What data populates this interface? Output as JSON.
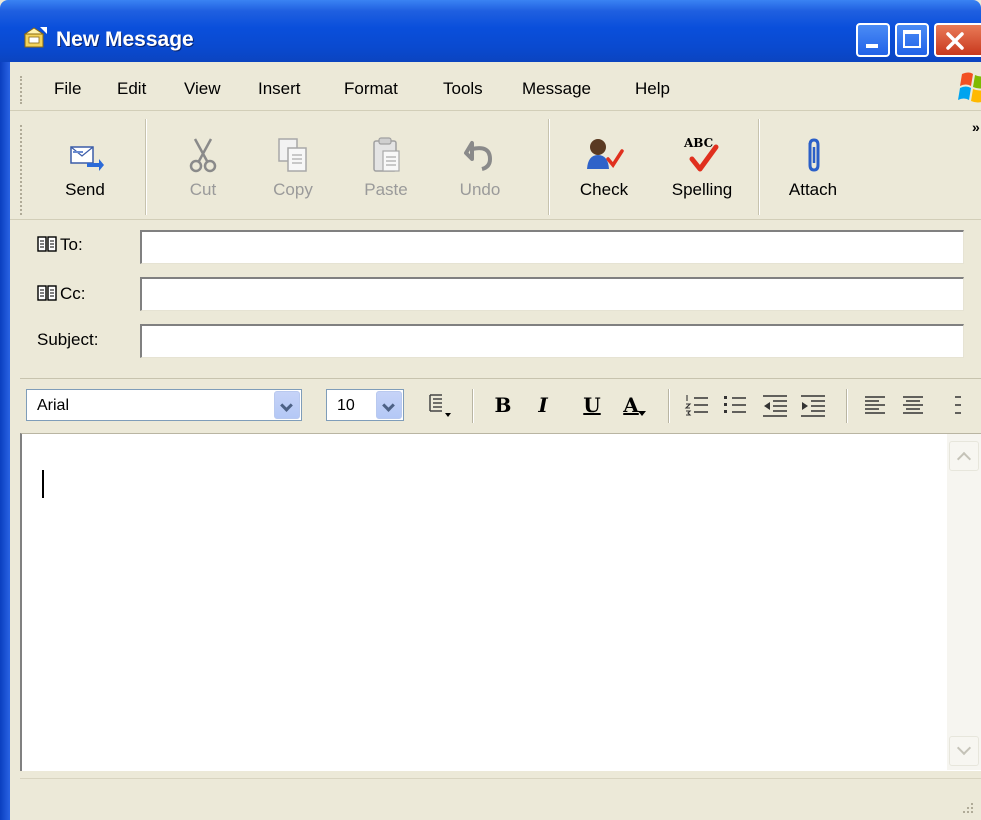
{
  "window": {
    "title": "New Message",
    "accent": "#0a4fdb",
    "controls": [
      "minimize-icon",
      "maximize-icon",
      "close-icon"
    ],
    "close_color": "#c8381d"
  },
  "menu": {
    "items": [
      "File",
      "Edit",
      "View",
      "Insert",
      "Format",
      "Tools",
      "Message",
      "Help"
    ]
  },
  "toolbar": {
    "buttons": [
      {
        "label": "Send",
        "icon": "send-icon",
        "enabled": true
      },
      {
        "label": "Cut",
        "icon": "scissors-icon",
        "enabled": false
      },
      {
        "label": "Copy",
        "icon": "copy-icon",
        "enabled": false
      },
      {
        "label": "Paste",
        "icon": "paste-icon",
        "enabled": false
      },
      {
        "label": "Undo",
        "icon": "undo-icon",
        "enabled": false
      },
      {
        "label": "Check",
        "icon": "check-names-icon",
        "enabled": true
      },
      {
        "label": "Spelling",
        "icon": "spelling-icon",
        "enabled": true
      },
      {
        "label": "Attach",
        "icon": "paperclip-icon",
        "enabled": true
      }
    ],
    "spelling_text": "ABC",
    "overflow": "»"
  },
  "fields": {
    "to": {
      "label": "To:",
      "value": ""
    },
    "cc": {
      "label": "Cc:",
      "value": ""
    },
    "subject": {
      "label": "Subject:",
      "value": ""
    }
  },
  "format": {
    "font": "Arial",
    "size": "10",
    "bold": "B",
    "italic": "I",
    "underline": "U",
    "font_color": "A"
  },
  "body": {
    "text": ""
  }
}
